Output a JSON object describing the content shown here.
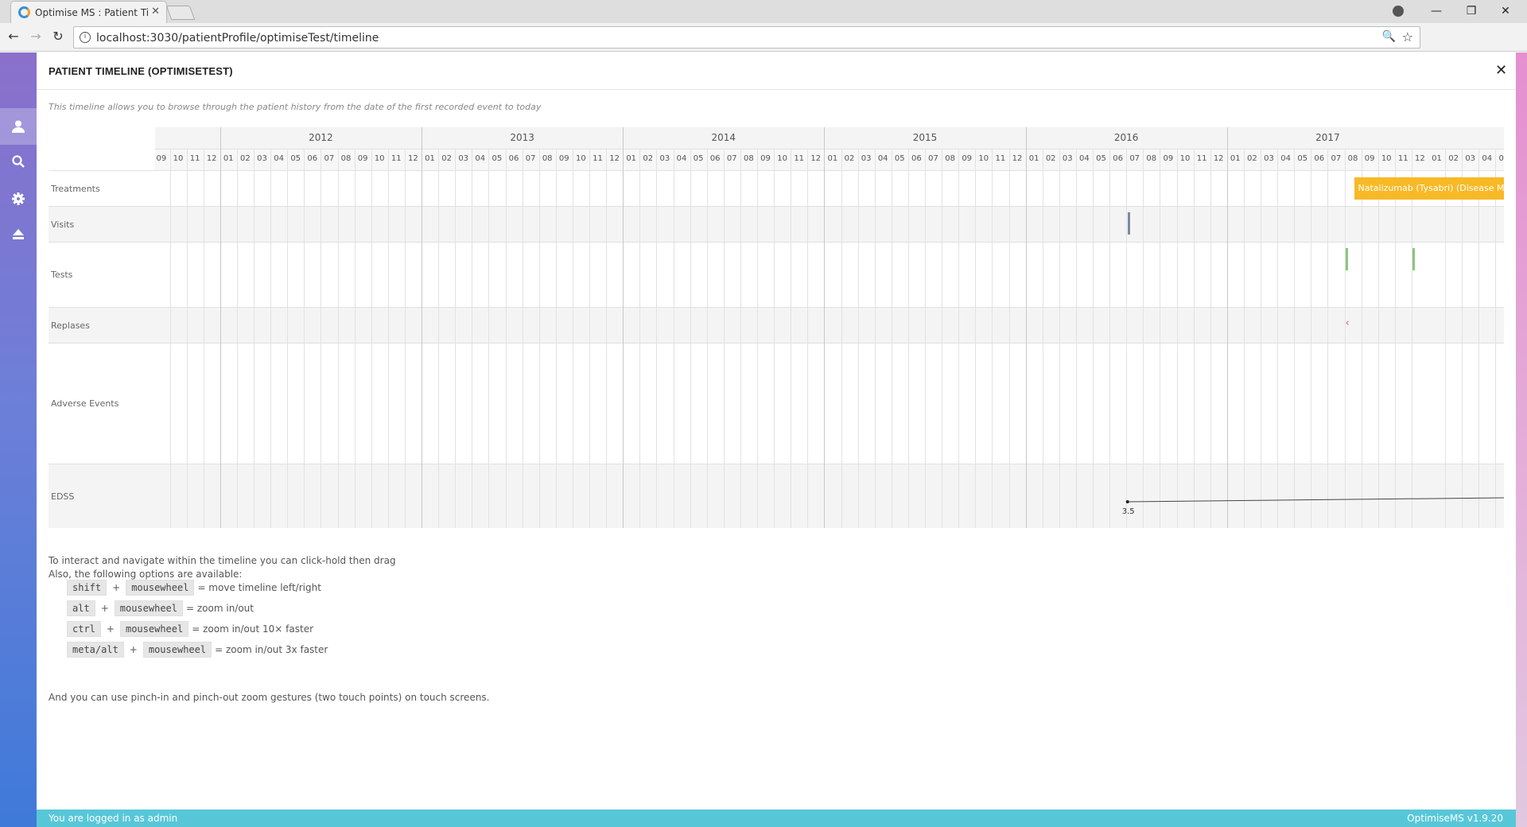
{
  "browser": {
    "tab_title": "Optimise MS : Patient Tim",
    "tab_close": "✕",
    "url": "localhost:3030/patientProfile/optimiseTest/timeline",
    "window_controls": [
      "—",
      "❐",
      "✕"
    ]
  },
  "sidebar": {
    "items": [
      {
        "name": "user-icon",
        "glyph": "👤"
      },
      {
        "name": "search-icon",
        "glyph": "🔍"
      },
      {
        "name": "gear-icon",
        "glyph": "⚙"
      },
      {
        "name": "eject-icon",
        "glyph": "⏏"
      }
    ]
  },
  "panel": {
    "title": "PATIENT TIMELINE (OPTIMISETEST)",
    "close": "✕",
    "description": "This timeline allows you to browse through the patient history from the date of the first recorded event to today"
  },
  "timeline": {
    "years": [
      "2012",
      "2013",
      "2014",
      "2015",
      "2016",
      "2017"
    ],
    "start_month": "2011-09",
    "month_count": 81,
    "rows": [
      {
        "label": "Treatments"
      },
      {
        "label": "Visits"
      },
      {
        "label": "Tests"
      },
      {
        "label": "Replases"
      },
      {
        "label": "Adverse Events"
      },
      {
        "label": "EDSS"
      }
    ],
    "treatment": {
      "label": "Natalizumab (Tysabri) (Disease Mod",
      "start": "2017-08",
      "color": "#f8b926"
    },
    "visits": [
      {
        "date": "2016-07",
        "color": "#7a8aa8"
      }
    ],
    "tests": [
      {
        "date": "2017-08",
        "color": "#8bc77b"
      },
      {
        "date": "2017-12",
        "color": "#8bc77b"
      }
    ],
    "relapses": [
      {
        "date": "2017-08",
        "glyph": "‹",
        "color": "#e06060"
      }
    ],
    "edss": {
      "points": [
        {
          "date": "2016-07",
          "value": "3.5"
        }
      ]
    }
  },
  "help": {
    "line1": "To interact and navigate within the timeline you can click-hold then drag",
    "line2": "Also, the following options are available:",
    "shortcuts": [
      {
        "key1": "shift",
        "key2": "mousewheel",
        "desc": "= move timeline left/right"
      },
      {
        "key1": "alt",
        "key2": "mousewheel",
        "desc": "= zoom in/out"
      },
      {
        "key1": "ctrl",
        "key2": "mousewheel",
        "desc": "= zoom in/out 10× faster"
      },
      {
        "key1": "meta/alt",
        "key2": "mousewheel",
        "desc": "= zoom in/out 3x faster"
      }
    ],
    "plus": "+",
    "touch": "And you can use pinch-in and pinch-out zoom gestures (two touch points) on touch screens."
  },
  "footer": {
    "left": "You are logged in as admin",
    "right": "OptimiseMS v1.9.20"
  }
}
